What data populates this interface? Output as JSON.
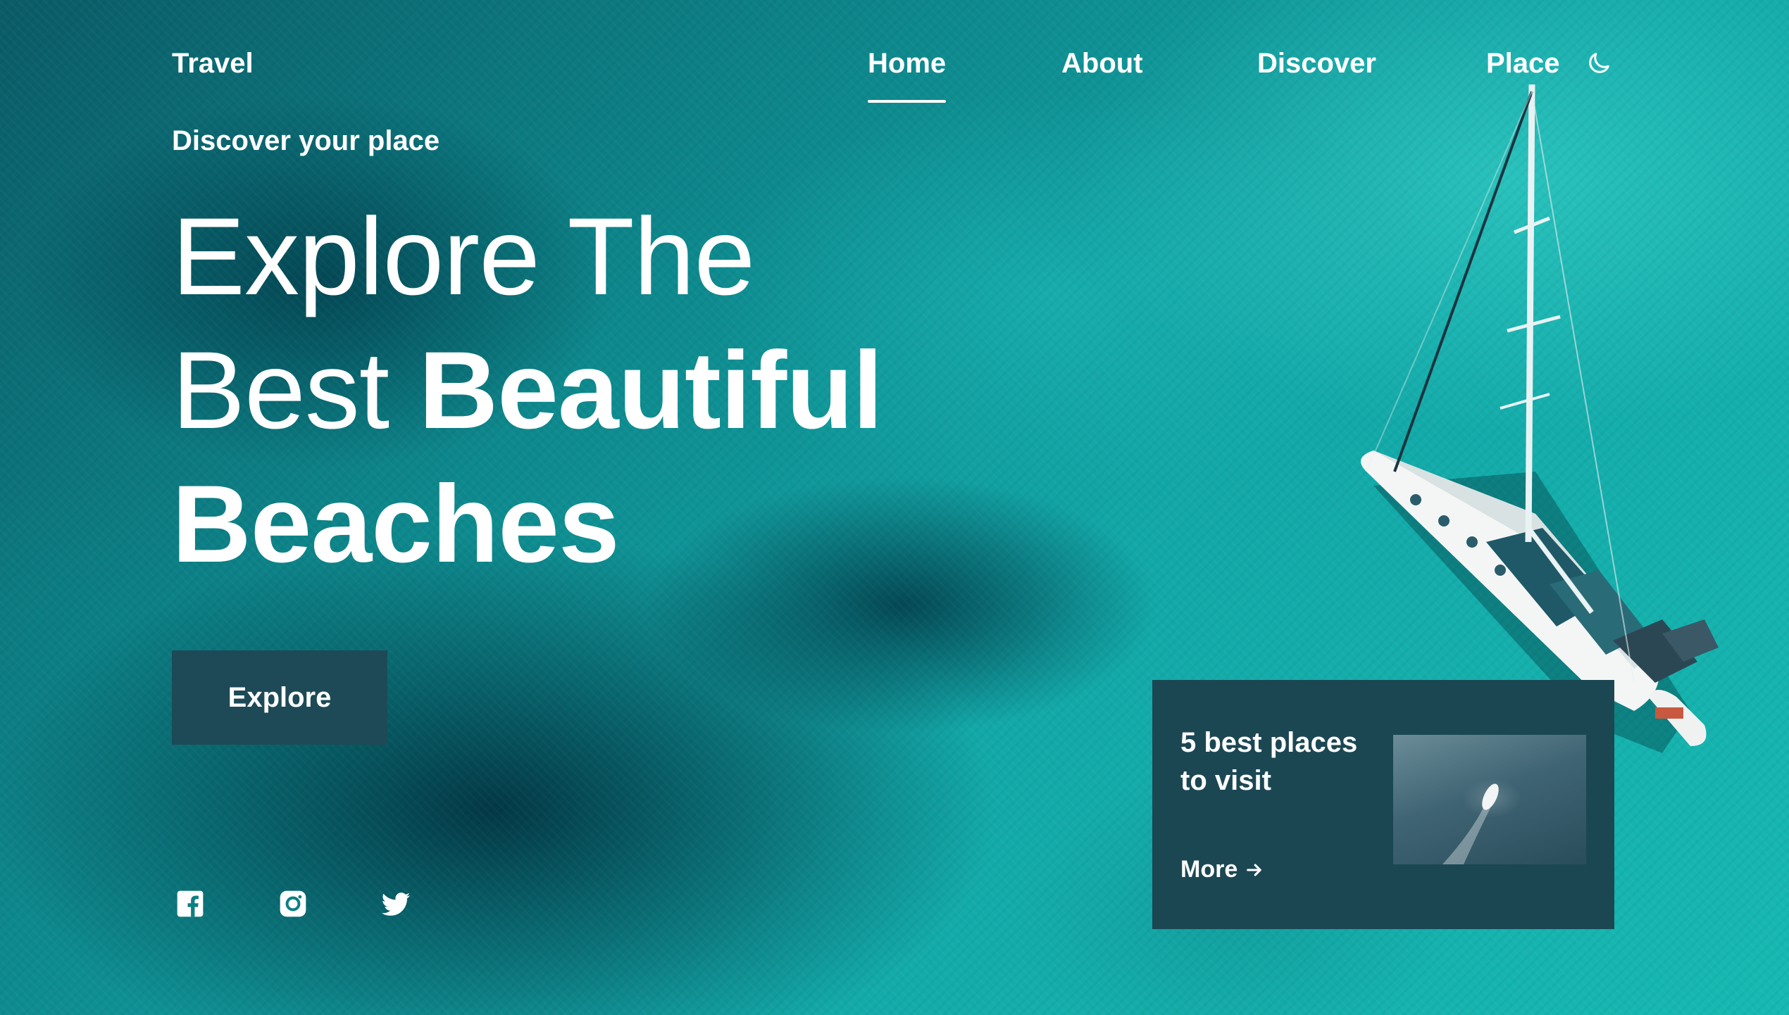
{
  "header": {
    "logo": "Travel",
    "nav": [
      {
        "label": "Home",
        "active": true
      },
      {
        "label": "About",
        "active": false
      },
      {
        "label": "Discover",
        "active": false
      },
      {
        "label": "Place",
        "active": false
      }
    ],
    "theme_toggle_icon": "moon-icon"
  },
  "hero": {
    "subtitle": "Discover your place",
    "title_line1": "Explore The",
    "title_line2_regular": "Best ",
    "title_line2_bold": "Beautiful",
    "title_line3_bold": "Beaches",
    "button_label": "Explore"
  },
  "social": [
    {
      "icon": "facebook-icon"
    },
    {
      "icon": "instagram-icon"
    },
    {
      "icon": "twitter-icon"
    }
  ],
  "card": {
    "title": "5 best places to visit",
    "more_label": "More",
    "more_icon": "arrow-right-icon"
  },
  "colors": {
    "accent_dark": "#1d4a56",
    "card_bg": "#1b4753",
    "text": "#ffffff"
  }
}
